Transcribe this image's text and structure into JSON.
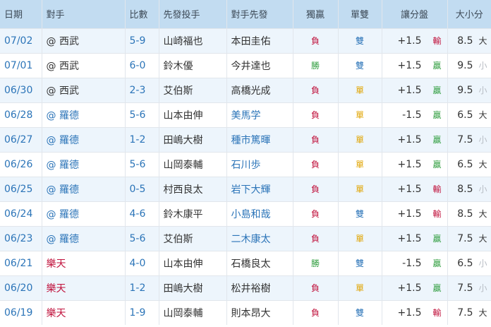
{
  "headers": [
    "日期",
    "對手",
    "比數",
    "先發投手",
    "對手先發",
    "獨贏",
    "單雙",
    "讓分盤",
    "大小分"
  ],
  "colors": {
    "header_bg": "#c2dcf1",
    "link_blue": "#2b74b8",
    "red": "#c0123c",
    "green": "#2f9d3e",
    "orange": "#e0a400",
    "muted": "#b8bdc4"
  },
  "rows": [
    {
      "date": "07/02",
      "opp": "@ 西武",
      "opp_color": "plain",
      "score": "5-9",
      "pitcher": "山崎福也",
      "opp_pitcher": "本田圭佑",
      "opp_pitcher_link": false,
      "ml": "負",
      "ml_type": "loss",
      "oe": "雙",
      "oe_type": "even",
      "spread": "+1.5",
      "spread_res": "輸",
      "spread_type": "loss",
      "ou": "8.5",
      "ou_res": "大",
      "ou_type": "big"
    },
    {
      "date": "07/01",
      "opp": "@ 西武",
      "opp_color": "plain",
      "score": "6-0",
      "pitcher": "鈴木優",
      "opp_pitcher": "今井達也",
      "opp_pitcher_link": false,
      "ml": "勝",
      "ml_type": "win",
      "oe": "雙",
      "oe_type": "even",
      "spread": "+1.5",
      "spread_res": "贏",
      "spread_type": "win",
      "ou": "9.5",
      "ou_res": "小",
      "ou_type": "small"
    },
    {
      "date": "06/30",
      "opp": "@ 西武",
      "opp_color": "plain",
      "score": "2-3",
      "pitcher": "艾伯斯",
      "opp_pitcher": "高橋光成",
      "opp_pitcher_link": false,
      "ml": "負",
      "ml_type": "loss",
      "oe": "單",
      "oe_type": "odd",
      "spread": "+1.5",
      "spread_res": "贏",
      "spread_type": "win",
      "ou": "9.5",
      "ou_res": "小",
      "ou_type": "small"
    },
    {
      "date": "06/28",
      "opp": "@ 羅德",
      "opp_color": "blue",
      "score": "5-6",
      "pitcher": "山本由伸",
      "opp_pitcher": "美馬学",
      "opp_pitcher_link": true,
      "ml": "負",
      "ml_type": "loss",
      "oe": "單",
      "oe_type": "odd",
      "spread": "-1.5",
      "spread_res": "贏",
      "spread_type": "win",
      "ou": "6.5",
      "ou_res": "大",
      "ou_type": "big"
    },
    {
      "date": "06/27",
      "opp": "@ 羅德",
      "opp_color": "blue",
      "score": "1-2",
      "pitcher": "田嶋大樹",
      "opp_pitcher": "種市篤暉",
      "opp_pitcher_link": true,
      "ml": "負",
      "ml_type": "loss",
      "oe": "單",
      "oe_type": "odd",
      "spread": "+1.5",
      "spread_res": "贏",
      "spread_type": "win",
      "ou": "7.5",
      "ou_res": "小",
      "ou_type": "small"
    },
    {
      "date": "06/26",
      "opp": "@ 羅德",
      "opp_color": "blue",
      "score": "5-6",
      "pitcher": "山岡泰輔",
      "opp_pitcher": "石川歩",
      "opp_pitcher_link": true,
      "ml": "負",
      "ml_type": "loss",
      "oe": "單",
      "oe_type": "odd",
      "spread": "+1.5",
      "spread_res": "贏",
      "spread_type": "win",
      "ou": "6.5",
      "ou_res": "大",
      "ou_type": "big"
    },
    {
      "date": "06/25",
      "opp": "@ 羅德",
      "opp_color": "blue",
      "score": "0-5",
      "pitcher": "村西良太",
      "opp_pitcher": "岩下大輝",
      "opp_pitcher_link": true,
      "ml": "負",
      "ml_type": "loss",
      "oe": "單",
      "oe_type": "odd",
      "spread": "+1.5",
      "spread_res": "輸",
      "spread_type": "loss",
      "ou": "8.5",
      "ou_res": "小",
      "ou_type": "small"
    },
    {
      "date": "06/24",
      "opp": "@ 羅德",
      "opp_color": "blue",
      "score": "4-6",
      "pitcher": "鈴木康平",
      "opp_pitcher": "小島和哉",
      "opp_pitcher_link": true,
      "ml": "負",
      "ml_type": "loss",
      "oe": "雙",
      "oe_type": "even",
      "spread": "+1.5",
      "spread_res": "輸",
      "spread_type": "loss",
      "ou": "8.5",
      "ou_res": "大",
      "ou_type": "big"
    },
    {
      "date": "06/23",
      "opp": "@ 羅德",
      "opp_color": "blue",
      "score": "5-6",
      "pitcher": "艾伯斯",
      "opp_pitcher": "二木康太",
      "opp_pitcher_link": true,
      "ml": "負",
      "ml_type": "loss",
      "oe": "單",
      "oe_type": "odd",
      "spread": "+1.5",
      "spread_res": "贏",
      "spread_type": "win",
      "ou": "7.5",
      "ou_res": "大",
      "ou_type": "big"
    },
    {
      "date": "06/21",
      "opp": "樂天",
      "opp_color": "red",
      "score": "4-0",
      "pitcher": "山本由伸",
      "opp_pitcher": "石橋良太",
      "opp_pitcher_link": false,
      "ml": "勝",
      "ml_type": "win",
      "oe": "雙",
      "oe_type": "even",
      "spread": "-1.5",
      "spread_res": "贏",
      "spread_type": "win",
      "ou": "6.5",
      "ou_res": "小",
      "ou_type": "small"
    },
    {
      "date": "06/20",
      "opp": "樂天",
      "opp_color": "red",
      "score": "1-2",
      "pitcher": "田嶋大樹",
      "opp_pitcher": "松井裕樹",
      "opp_pitcher_link": false,
      "ml": "負",
      "ml_type": "loss",
      "oe": "單",
      "oe_type": "odd",
      "spread": "+1.5",
      "spread_res": "贏",
      "spread_type": "win",
      "ou": "7.5",
      "ou_res": "小",
      "ou_type": "small"
    },
    {
      "date": "06/19",
      "opp": "樂天",
      "opp_color": "red",
      "score": "1-9",
      "pitcher": "山岡泰輔",
      "opp_pitcher": "則本昂大",
      "opp_pitcher_link": false,
      "ml": "負",
      "ml_type": "loss",
      "oe": "雙",
      "oe_type": "even",
      "spread": "+1.5",
      "spread_res": "輸",
      "spread_type": "loss",
      "ou": "7.5",
      "ou_res": "大",
      "ou_type": "big"
    }
  ]
}
